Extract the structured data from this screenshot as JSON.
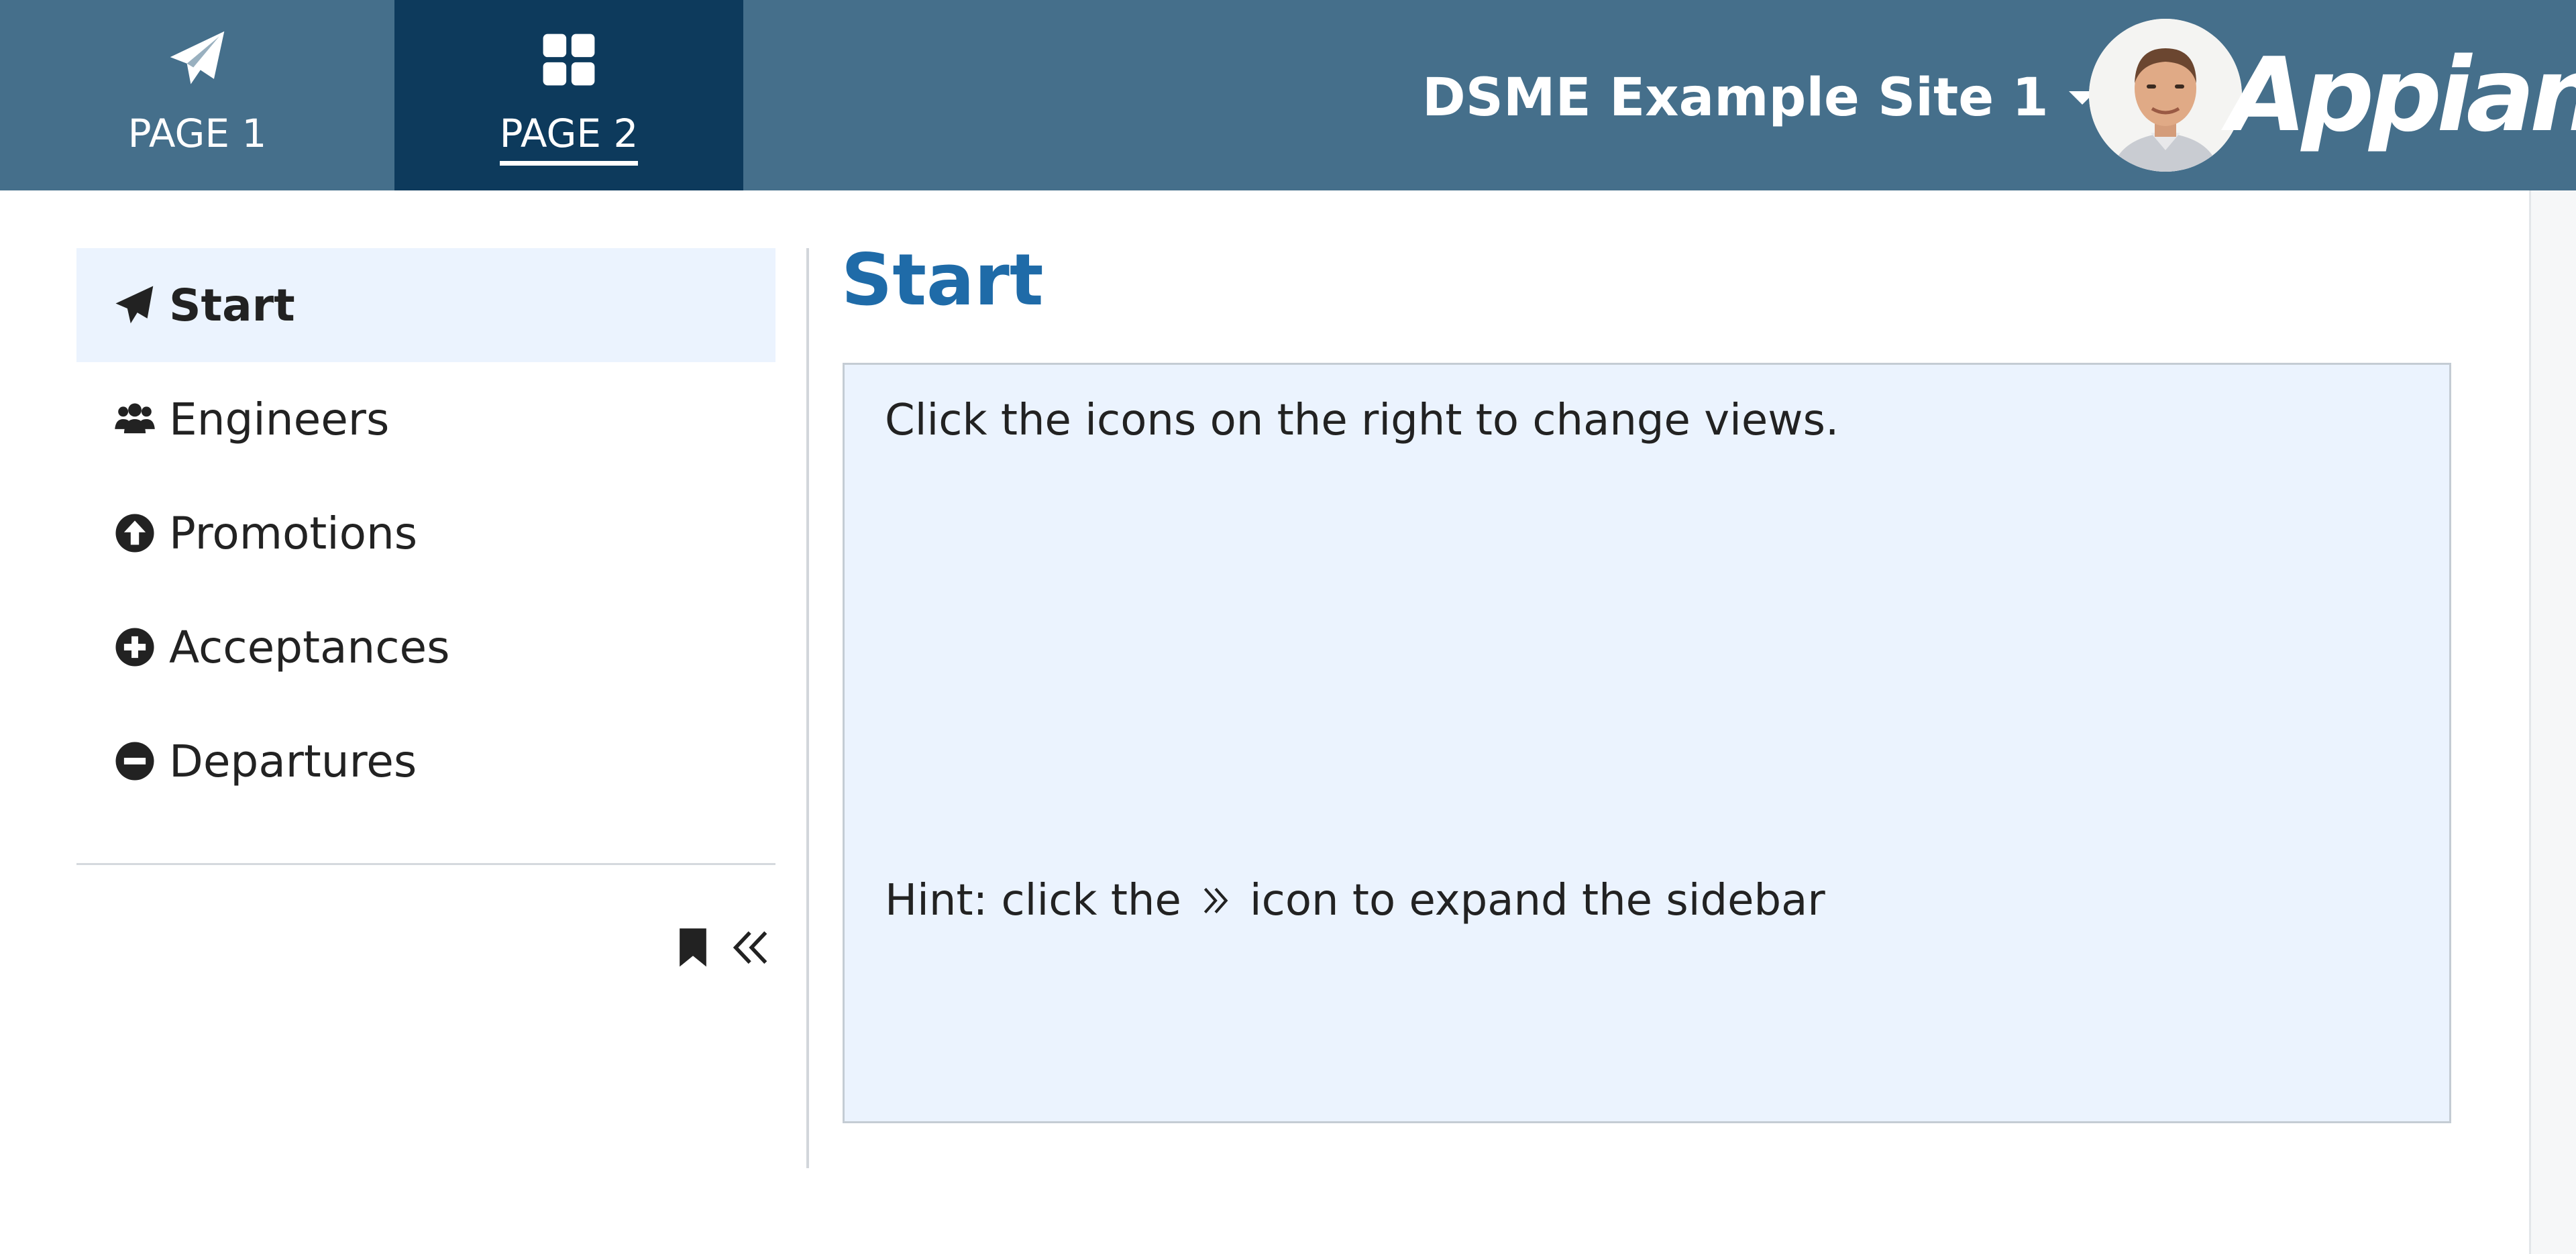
{
  "header": {
    "tabs": [
      {
        "label": "PAGE 1",
        "icon": "paper-plane-icon",
        "active": false
      },
      {
        "label": "PAGE 2",
        "icon": "grid-icon",
        "active": true
      }
    ],
    "site_name": "DSME Example Site 1",
    "logo_text": "Appian",
    "colors": {
      "header_bg": "#456f8b",
      "active_tab_bg": "#0d3a5c"
    }
  },
  "sidebar": {
    "items": [
      {
        "label": "Start",
        "icon": "paper-plane-icon",
        "active": true
      },
      {
        "label": "Engineers",
        "icon": "users-icon",
        "active": false
      },
      {
        "label": "Promotions",
        "icon": "arrow-circle-up-icon",
        "active": false
      },
      {
        "label": "Acceptances",
        "icon": "plus-circle-icon",
        "active": false
      },
      {
        "label": "Departures",
        "icon": "minus-circle-icon",
        "active": false
      }
    ],
    "actions": [
      {
        "name": "bookmark-icon"
      },
      {
        "name": "collapse-sidebar-icon"
      }
    ]
  },
  "main": {
    "title": "Start",
    "card": {
      "line1": "Click the icons on the right to change views.",
      "hint_before": "Hint: click the",
      "hint_after": "icon to expand the sidebar"
    },
    "colors": {
      "title": "#1f6ba8",
      "card_bg": "#ebf3fe"
    }
  }
}
